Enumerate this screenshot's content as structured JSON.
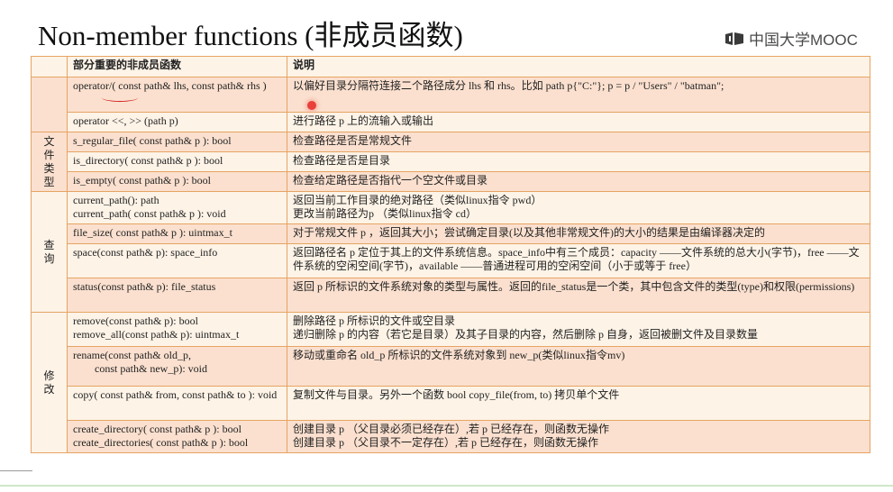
{
  "title": "Non-member functions (非成员函数)",
  "logo": {
    "text": "中国大学MOOC",
    "icon": "mooc-logo-icon"
  },
  "colors": {
    "border": "#e6a463",
    "row_bg": "#fdf3e7",
    "highlight_bg": "#fbe0cf"
  },
  "table": {
    "headers": [
      "部分重要的非成员函数",
      "说明"
    ],
    "groups": [
      {
        "category": [],
        "rows": [
          {
            "func": [
              "operator/( const path& lhs, const path& rhs )"
            ],
            "desc": [
              "以偏好目录分隔符连接二个路径成分 lhs 和 rhs。比如 path p{\"C:\"}; p = p / \"Users\" / \"batman\";"
            ]
          },
          {
            "func": [
              "operator <<, >> (path p)"
            ],
            "desc": [
              "进行路径 p 上的流输入或输出"
            ]
          }
        ]
      },
      {
        "category": [
          "文",
          "件",
          "类",
          "型"
        ],
        "rows": [
          {
            "func": [
              "s_regular_file( const path& p ): bool"
            ],
            "desc": [
              "检查路径是否是常规文件"
            ]
          },
          {
            "func": [
              "is_directory( const path& p ): bool"
            ],
            "desc": [
              "检查路径是否是目录"
            ]
          },
          {
            "func": [
              "is_empty( const path& p ): bool"
            ],
            "desc": [
              "检查给定路径是否指代一个空文件或目录"
            ]
          }
        ]
      },
      {
        "category": [
          "查",
          "询"
        ],
        "rows": [
          {
            "func": [
              "current_path(): path",
              "current_path( const path& p ): void"
            ],
            "desc": [
              "返回当前工作目录的绝对路径（类似linux指令 pwd）",
              "更改当前路径为p （类似linux指令 cd）"
            ]
          },
          {
            "func": [
              "file_size( const path& p ): uintmax_t"
            ],
            "desc": [
              "对于常规文件 p ，返回其大小；尝试确定目录(以及其他非常规文件)的大小的结果是由编译器决定的"
            ]
          },
          {
            "func": [
              "space(const path& p): space_info"
            ],
            "desc": [
              "返回路径名 p 定位于其上的文件系统信息。space_info中有三个成员：capacity ——文件系统的总大小(字节)，free ——文件系统的空闲空间(字节)，available ——普通进程可用的空闲空间（小于或等于 free）"
            ]
          },
          {
            "func": [
              "status(const path& p): file_status"
            ],
            "desc": [
              "返回 p 所标识的文件系统对象的类型与属性。返回的file_status是一个类，其中包含文件的类型(type)和权限(permissions)"
            ]
          }
        ]
      },
      {
        "category": [
          "修",
          "改"
        ],
        "rows": [
          {
            "func": [
              "remove(const path& p): bool",
              "remove_all(const path& p): uintmax_t"
            ],
            "desc": [
              "删除路径 p 所标识的文件或空目录",
              "递归删除 p 的内容（若它是目录）及其子目录的内容，然后删除 p 自身，返回被删文件及目录数量"
            ]
          },
          {
            "func": [
              "rename(const path& old_p,",
              "        const path& new_p): void"
            ],
            "desc": [
              "移动或重命名 old_p 所标识的文件系统对象到 new_p(类似linux指令mv)"
            ]
          },
          {
            "func": [
              "copy( const path& from, const path& to ): void"
            ],
            "desc": [
              "复制文件与目录。另外一个函数 bool copy_file(from, to) 拷贝单个文件"
            ]
          },
          {
            "func": [
              "create_directory( const path& p ): bool",
              "create_directories( const path& p ): bool"
            ],
            "desc": [
              "创建目录 p （父目录必须已经存在）,若 p 已经存在，则函数无操作",
              "创建目录 p （父目录不一定存在）,若 p 已经存在，则函数无操作"
            ]
          }
        ]
      }
    ]
  }
}
